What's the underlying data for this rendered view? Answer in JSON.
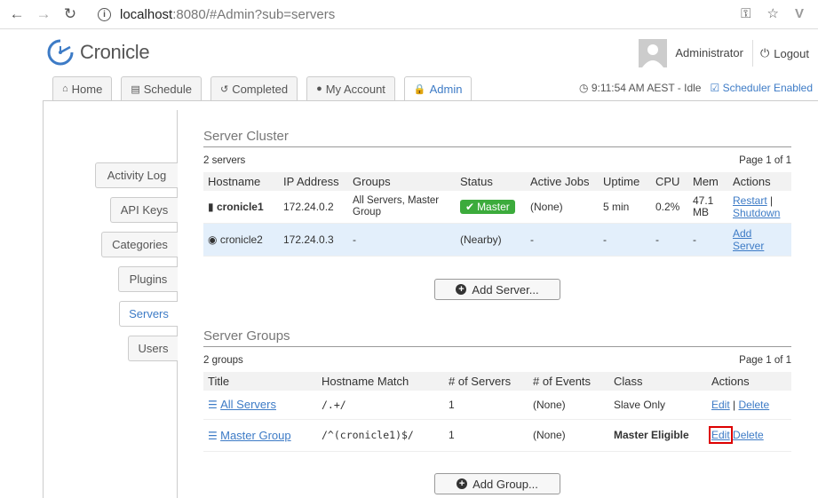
{
  "browser": {
    "url_host": "localhost",
    "url_path": ":8080/#Admin?sub=servers"
  },
  "app": {
    "logo_text": "Cronicle",
    "user_name": "Administrator",
    "logout_label": "Logout"
  },
  "tabs": [
    {
      "label": "Home",
      "icon": "home-icon"
    },
    {
      "label": "Schedule",
      "icon": "calendar-icon"
    },
    {
      "label": "Completed",
      "icon": "history-icon"
    },
    {
      "label": "My Account",
      "icon": "user-icon"
    },
    {
      "label": "Admin",
      "icon": "lock-icon"
    }
  ],
  "status": {
    "time": "9:11:54 AM AEST - Idle",
    "scheduler": "Scheduler Enabled"
  },
  "sidebar": {
    "items": [
      "Activity Log",
      "API Keys",
      "Categories",
      "Plugins",
      "Servers",
      "Users"
    ],
    "active": "Servers"
  },
  "server_cluster": {
    "title": "Server Cluster",
    "count": "2 servers",
    "page": "Page 1 of 1",
    "columns": [
      "Hostname",
      "IP Address",
      "Groups",
      "Status",
      "Active Jobs",
      "Uptime",
      "CPU",
      "Mem",
      "Actions"
    ],
    "rows": [
      {
        "hostname": "cronicle1",
        "ip": "172.24.0.2",
        "groups": "All Servers, Master Group",
        "status": "Master",
        "active_jobs": "(None)",
        "uptime": "5 min",
        "cpu": "0.2%",
        "mem": "47.1 MB",
        "action1": "Restart",
        "sep": "|",
        "action2": "Shutdown"
      },
      {
        "hostname": "cronicle2",
        "ip": "172.24.0.3",
        "groups": "-",
        "status": "(Nearby)",
        "active_jobs": "-",
        "uptime": "-",
        "cpu": "-",
        "mem": "-",
        "action1": "Add Server"
      }
    ],
    "add_button": "Add Server..."
  },
  "server_groups": {
    "title": "Server Groups",
    "count": "2 groups",
    "page": "Page 1 of 1",
    "columns": [
      "Title",
      "Hostname Match",
      "# of Servers",
      "# of Events",
      "Class",
      "Actions"
    ],
    "rows": [
      {
        "title": "All Servers",
        "match": "/.+/",
        "servers": "1",
        "events": "(None)",
        "class": "Slave Only",
        "edit": "Edit",
        "sep": "|",
        "delete": "Delete"
      },
      {
        "title": "Master Group",
        "match": "/^(cronicle1)$/",
        "servers": "1",
        "events": "(None)",
        "class": "Master Eligible",
        "edit": "Edit",
        "delete": "Delete"
      }
    ],
    "add_button": "Add Group..."
  }
}
